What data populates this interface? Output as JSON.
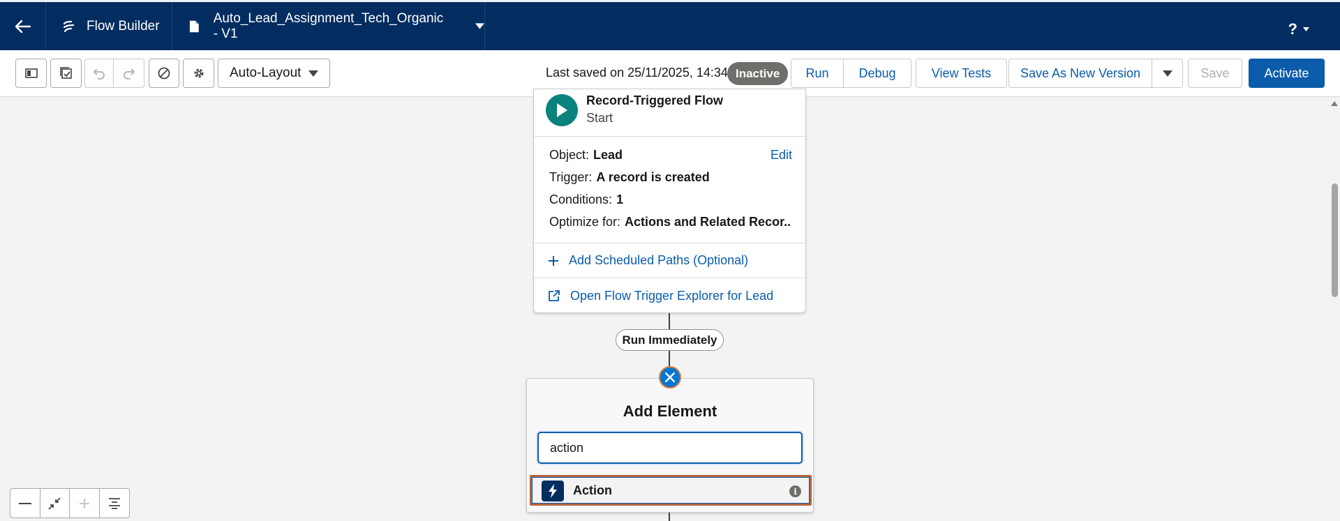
{
  "header": {
    "app_name": "Flow Builder",
    "flow_name": "Auto_Lead_Assignment_Tech_Organic - V1",
    "help_label": "?"
  },
  "toolbar": {
    "layout_mode": "Auto-Layout",
    "last_saved": "Last saved on 25/11/2025, 14:34",
    "status": "Inactive",
    "run": "Run",
    "debug": "Debug",
    "view_tests": "View Tests",
    "save_as_new_version": "Save As New Version",
    "save": "Save",
    "activate": "Activate"
  },
  "start_card": {
    "title": "Record-Triggered Flow",
    "subtitle": "Start",
    "edit": "Edit",
    "rows": [
      {
        "label": "Object:",
        "value": "Lead"
      },
      {
        "label": "Trigger:",
        "value": "A record is created"
      },
      {
        "label": "Conditions:",
        "value": "1"
      },
      {
        "label": "Optimize for:",
        "value": "Actions and Related Recor..."
      }
    ],
    "add_scheduled_paths": "Add Scheduled Paths (Optional)",
    "open_trigger_explorer": "Open Flow Trigger Explorer for Lead"
  },
  "path_label": "Run Immediately",
  "add_element": {
    "title": "Add Element",
    "search_value": "action",
    "results": [
      {
        "label": "Action"
      }
    ]
  },
  "colors": {
    "header_bg": "#032d60",
    "brand_blue": "#0b5cab",
    "start_icon": "#0b827c",
    "status_badge": "#706e6b"
  }
}
